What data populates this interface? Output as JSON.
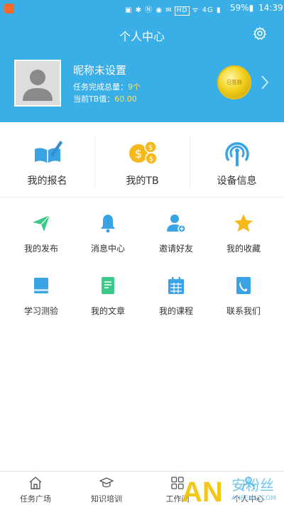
{
  "status_bar": {
    "indicators": "▣ ✱ Ⓝ ◉ ✉",
    "network_badge": "HD",
    "signal": "ᯤ 4G ▮",
    "battery": "59%▮",
    "time": "14:39"
  },
  "header": {
    "title": "个人中心",
    "accent_color": "#3aaee6"
  },
  "profile": {
    "nickname": "昵称未设置",
    "tasks_label": "任务完成总量：",
    "tasks_value": "9个",
    "tb_label": "当前TB值：",
    "tb_value": "60.00",
    "medal_text": "已签到"
  },
  "cards": [
    {
      "label": "我的报名",
      "icon": "book-pen-icon"
    },
    {
      "label": "我的TB",
      "icon": "coins-icon"
    },
    {
      "label": "设备信息",
      "icon": "device-signal-icon"
    }
  ],
  "grid": [
    {
      "label": "我的发布",
      "icon": "paper-plane-icon"
    },
    {
      "label": "消息中心",
      "icon": "bell-icon"
    },
    {
      "label": "邀请好友",
      "icon": "add-user-icon"
    },
    {
      "label": "我的收藏",
      "icon": "star-icon"
    },
    {
      "label": "学习测验",
      "icon": "notebook-icon"
    },
    {
      "label": "我的文章",
      "icon": "document-icon"
    },
    {
      "label": "我的课程",
      "icon": "calendar-icon"
    },
    {
      "label": "联系我们",
      "icon": "phone-book-icon"
    }
  ],
  "tabbar": [
    {
      "label": "任务广场",
      "icon": "home-icon"
    },
    {
      "label": "知识培训",
      "icon": "graduation-cap-icon"
    },
    {
      "label": "工作间",
      "icon": "grid-icon"
    },
    {
      "label": "个人中心",
      "icon": "user-icon"
    }
  ],
  "watermark": {
    "logo_text": "AN",
    "brand": "安粉丝",
    "domain": "ANFENSI.COM"
  }
}
